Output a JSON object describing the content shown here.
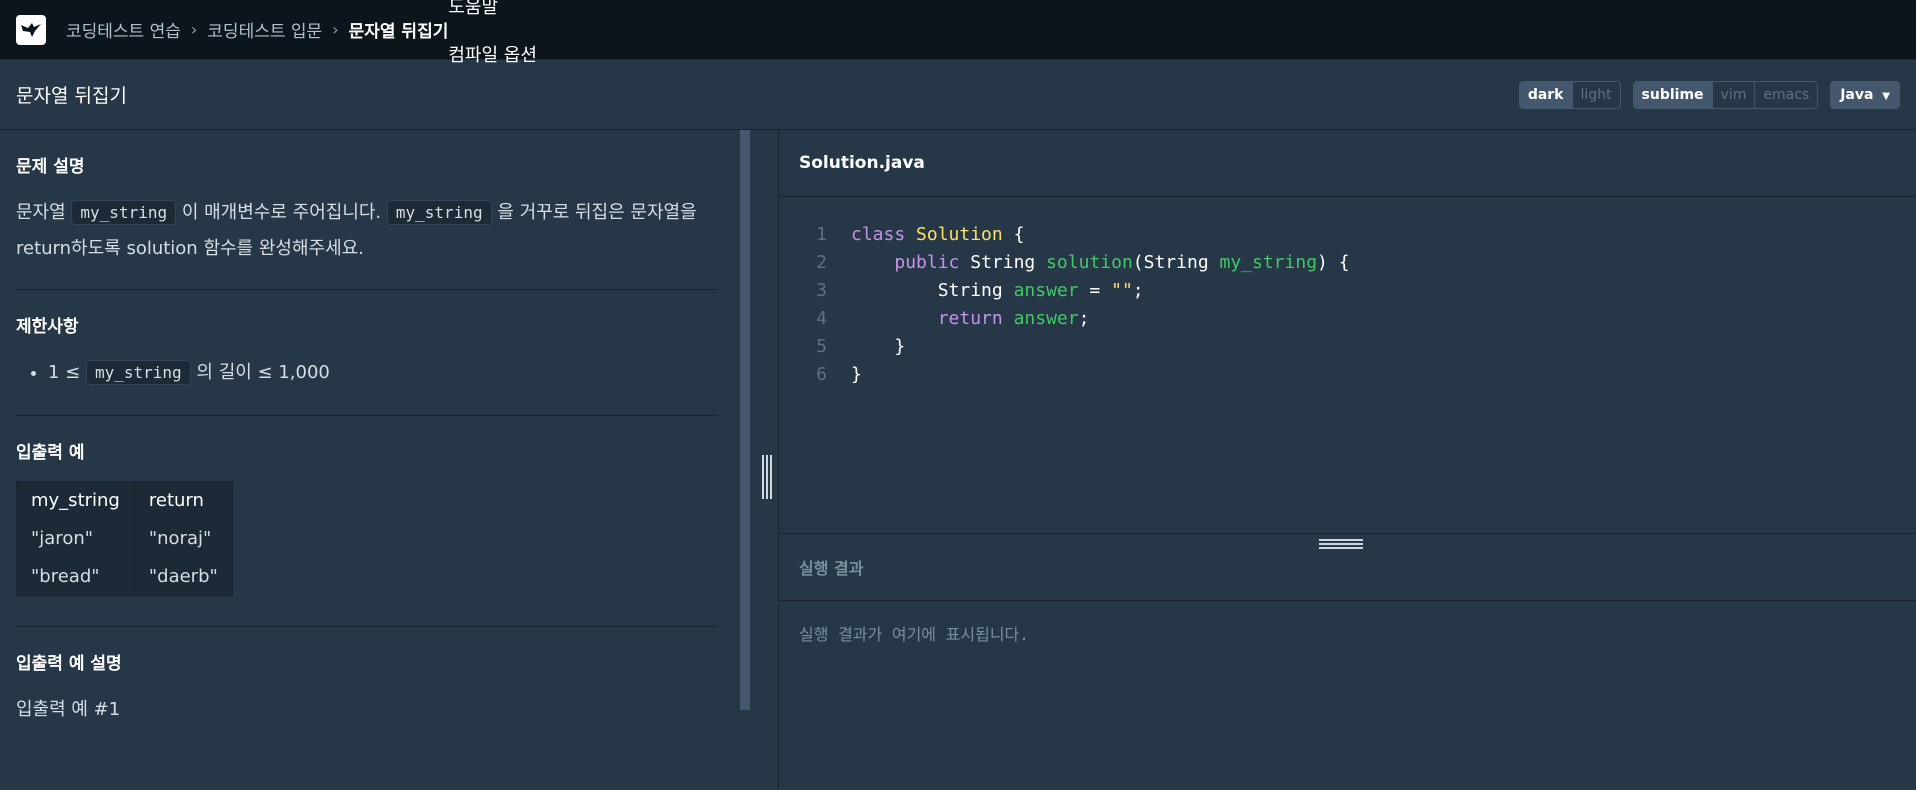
{
  "nav": {
    "breadcrumbs": [
      "코딩테스트 연습",
      "코딩테스트 입문",
      "문자열 뒤집기"
    ],
    "help": "도움말",
    "compile_options": "컴파일 옵션"
  },
  "title": "문자열 뒤집기",
  "toolbar": {
    "theme": [
      "dark",
      "light"
    ],
    "keymap": [
      "sublime",
      "vim",
      "emacs"
    ],
    "language": "Java"
  },
  "problem": {
    "desc_heading": "문제 설명",
    "desc_p1": "문자열 ",
    "desc_code1": "my_string",
    "desc_p2": " 이 매개변수로 주어집니다. ",
    "desc_code2": "my_string",
    "desc_p3": " 을 거꾸로 뒤집은 문자열을 return하도록 solution 함수를 완성해주세요.",
    "limits_heading": "제한사항",
    "limit_pre": "1 ≤ ",
    "limit_code": "my_string",
    "limit_post": " 의 길이 ≤ 1,000",
    "io_heading": "입출력 예",
    "io_headers": [
      "my_string",
      "return"
    ],
    "io_rows": [
      [
        "\"jaron\"",
        "\"noraj\""
      ],
      [
        "\"bread\"",
        "\"daerb\""
      ]
    ],
    "io_desc_heading": "입출력 예 설명",
    "io_desc_item": "입출력 예 #1"
  },
  "editor": {
    "filename": "Solution.java",
    "line_numbers": [
      "1",
      "2",
      "3",
      "4",
      "5",
      "6"
    ],
    "code": {
      "l1_kw": "class",
      "l1_cls": "Solution",
      "l1_rest": " {",
      "l2_kw": "public",
      "l2_type": " String ",
      "l2_fn": "solution",
      "l2_p1": "(String ",
      "l2_var": "my_string",
      "l2_p2": ") {",
      "l3_type": "String ",
      "l3_var": "answer",
      "l3_eq": " = ",
      "l3_str": "\"\"",
      "l3_end": ";",
      "l4_kw": "return",
      "l4_var": "answer",
      "l4_end": ";",
      "l5": "}",
      "l6": "}"
    }
  },
  "output": {
    "heading": "실행 결과",
    "placeholder": "실행 결과가 여기에 표시됩니다."
  }
}
